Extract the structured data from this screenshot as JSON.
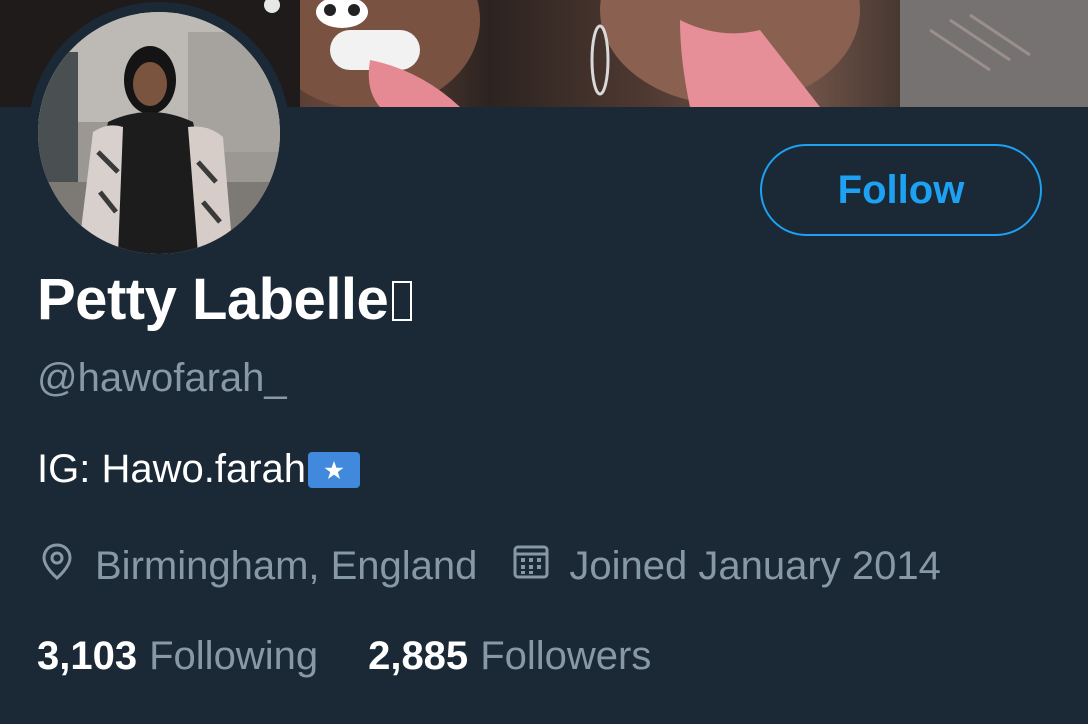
{
  "profile": {
    "display_name": "Petty Labelle",
    "handle": "@hawofarah_",
    "bio": "IG: Hawo.farah",
    "location": "Birmingham, England",
    "joined": "Joined January 2014"
  },
  "actions": {
    "follow_label": "Follow"
  },
  "stats": {
    "following_count": "3,103",
    "following_label": "Following",
    "followers_count": "2,885",
    "followers_label": "Followers"
  },
  "icons": {
    "location": "map-pin-icon",
    "joined": "calendar-icon",
    "bio_flag": "somalia-flag-emoji"
  },
  "colors": {
    "background": "#1b2836",
    "accent": "#1da1f2",
    "secondary_text": "#8899a6",
    "primary_text": "#ffffff"
  }
}
